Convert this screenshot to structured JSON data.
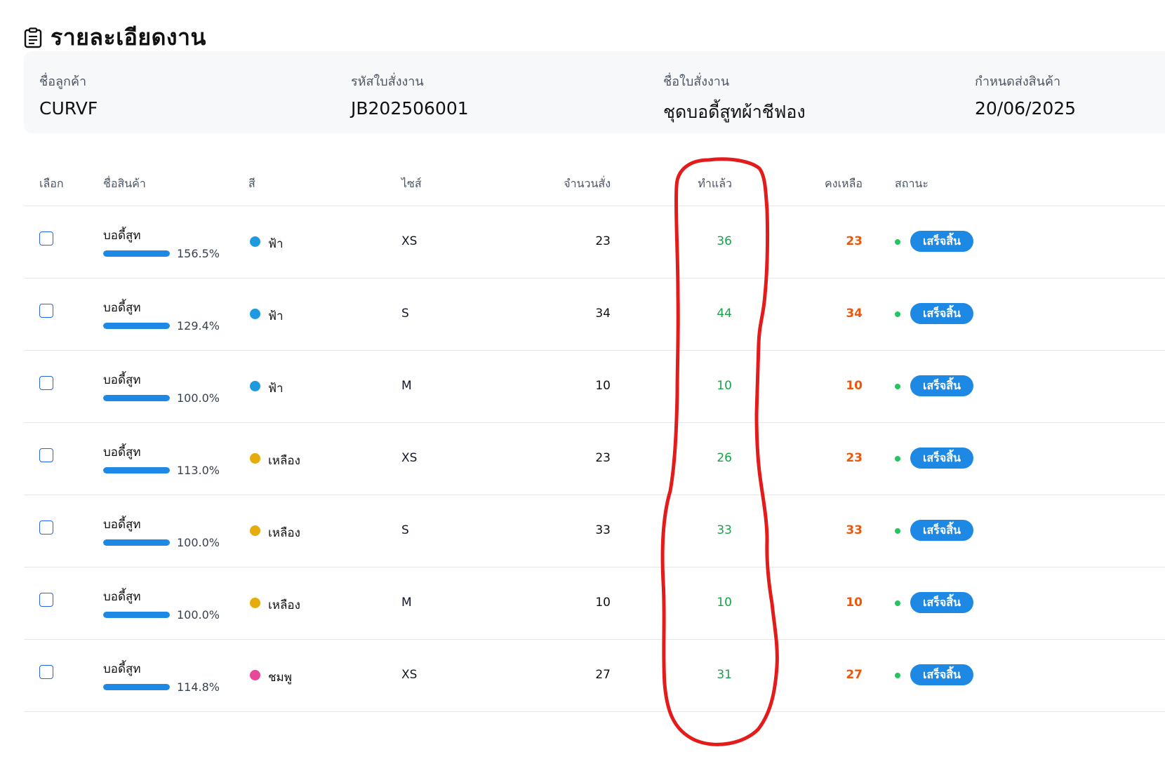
{
  "header": {
    "title": "รายละเอียดงาน",
    "icon": "clipboard-icon"
  },
  "info": {
    "customer": {
      "label": "ชื่อลูกค้า",
      "value": "CURVF"
    },
    "job_code": {
      "label": "รหัสใบสั่งงาน",
      "value": "JB202506001"
    },
    "job_name": {
      "label": "ชื่อใบสั่งงาน",
      "value": "ชุดบอดี้สูทผ้าชีฟอง"
    },
    "due_date": {
      "label": "กำหนดส่งสินค้า",
      "value": "20/06/2025"
    }
  },
  "table": {
    "columns": {
      "select": "เลือก",
      "product": "ชื่อสินค้า",
      "color": "สี",
      "size": "ไซส์",
      "ordered": "จำนวนสั่ง",
      "done": "ทำแล้ว",
      "remaining": "คงเหลือ",
      "status": "สถานะ"
    },
    "rows": [
      {
        "product": "บอดี้สูท",
        "progress": 1.565,
        "progress_label": "156.5%",
        "color": "ฟ้า",
        "color_hex": "#1e9be0",
        "size": "XS",
        "ordered": "23",
        "done": "36",
        "remaining": "23",
        "status": "เสร็จสิ้น"
      },
      {
        "product": "บอดี้สูท",
        "progress": 1.294,
        "progress_label": "129.4%",
        "color": "ฟ้า",
        "color_hex": "#1e9be0",
        "size": "S",
        "ordered": "34",
        "done": "44",
        "remaining": "34",
        "status": "เสร็จสิ้น"
      },
      {
        "product": "บอดี้สูท",
        "progress": 1.0,
        "progress_label": "100.0%",
        "color": "ฟ้า",
        "color_hex": "#1e9be0",
        "size": "M",
        "ordered": "10",
        "done": "10",
        "remaining": "10",
        "status": "เสร็จสิ้น"
      },
      {
        "product": "บอดี้สูท",
        "progress": 1.13,
        "progress_label": "113.0%",
        "color": "เหลือง",
        "color_hex": "#e6ac0c",
        "size": "XS",
        "ordered": "23",
        "done": "26",
        "remaining": "23",
        "status": "เสร็จสิ้น"
      },
      {
        "product": "บอดี้สูท",
        "progress": 1.0,
        "progress_label": "100.0%",
        "color": "เหลือง",
        "color_hex": "#e6ac0c",
        "size": "S",
        "ordered": "33",
        "done": "33",
        "remaining": "33",
        "status": "เสร็จสิ้น"
      },
      {
        "product": "บอดี้สูท",
        "progress": 1.0,
        "progress_label": "100.0%",
        "color": "เหลือง",
        "color_hex": "#e6ac0c",
        "size": "M",
        "ordered": "10",
        "done": "10",
        "remaining": "10",
        "status": "เสร็จสิ้น"
      },
      {
        "product": "บอดี้สูท",
        "progress": 1.148,
        "progress_label": "114.8%",
        "color": "ชมพู",
        "color_hex": "#e8479a",
        "size": "XS",
        "ordered": "27",
        "done": "31",
        "remaining": "27",
        "status": "เสร็จสิ้น"
      }
    ]
  },
  "colors": {
    "accent": "#1e88e5",
    "done_text": "#16a34a",
    "remaining_text": "#ea580c",
    "status_dot": "#22c55e",
    "annotation": "#e31b1b"
  }
}
